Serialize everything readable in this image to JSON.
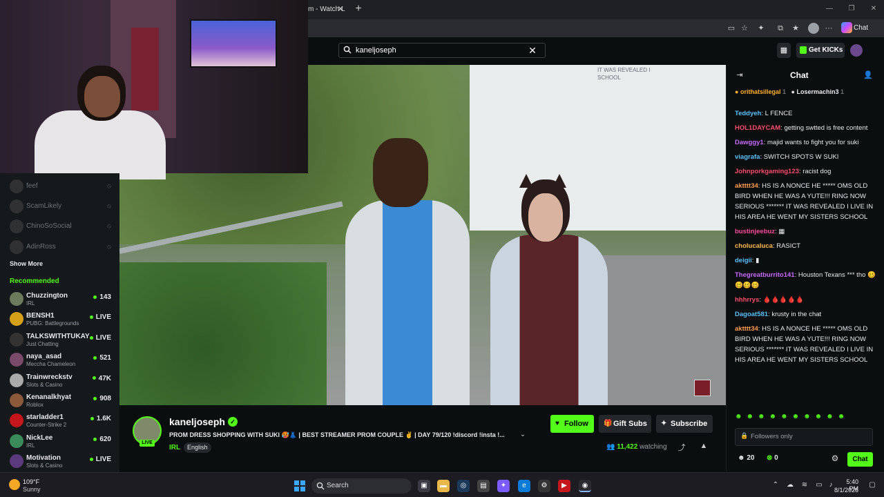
{
  "browser": {
    "tab_title": "m - Watch L",
    "close": "✕",
    "new_tab": "+",
    "controls": [
      "—",
      "❐",
      "✕"
    ],
    "copilot_label": "Chat"
  },
  "header": {
    "search_value": "kaneljoseph",
    "search_clear": "✕",
    "get_kicks": "Get KICKs"
  },
  "sidebar": {
    "following": [
      {
        "name": "feef"
      },
      {
        "name": "ScamLikely"
      },
      {
        "name": "ChinoSoSocial"
      },
      {
        "name": "AdinRoss"
      }
    ],
    "show_more": "Show More",
    "recommended_title": "Recommended",
    "recommended": [
      {
        "name": "Chuzzington",
        "category": "IRL",
        "viewers": "143"
      },
      {
        "name": "BENSH1",
        "category": "PUBG: Battlegrounds",
        "viewers": "LIVE"
      },
      {
        "name": "TALKSWITHTUKAY",
        "category": "Just Chatting",
        "viewers": "LIVE"
      },
      {
        "name": "naya_asad",
        "category": "Meccha Chameleon",
        "viewers": "521"
      },
      {
        "name": "Trainwreckstv",
        "category": "Slots & Casino",
        "viewers": "47K"
      },
      {
        "name": "Kenanalkhyat",
        "category": "Roblox",
        "viewers": "908"
      },
      {
        "name": "starladder1",
        "category": "Counter-Strike 2",
        "viewers": "1.6K"
      },
      {
        "name": "NickLee",
        "category": "IRL",
        "viewers": "620"
      },
      {
        "name": "Motivation",
        "category": "Slots & Casino",
        "viewers": "LIVE"
      }
    ]
  },
  "stream": {
    "overlay_line": "IT WAS REVEALED I",
    "overlay_line2": "SCHOOL",
    "streamer": "kaneljoseph",
    "live": "LIVE",
    "title": "PROM DRESS SHOPPING WITH SUKI 🥵👗 | BEST STREAMER PROM COUPLE ✌️ | DAY 79/120 !discord !insta !...",
    "category": "IRL",
    "tag": "English",
    "follow": "Follow",
    "gift_subs": "Gift Subs",
    "subscribe": "Subscribe",
    "viewers": "11,422",
    "watching": "watching"
  },
  "chat": {
    "title": "Chat",
    "pinned": [
      {
        "name": "orithatsillegal",
        "count": "1"
      },
      {
        "name": "Losermachin3",
        "count": "1"
      }
    ],
    "messages": [
      {
        "user": "Teddyeh",
        "color": "#5bc0ff",
        "text": "L FENCE"
      },
      {
        "user": "HOL1DAYCAM",
        "color": "#ff4d6d",
        "text": "getting swtted is free content"
      },
      {
        "user": "Dawggy1",
        "color": "#c86bff",
        "text": "majid wants to fight you for suki"
      },
      {
        "user": "viagrafa",
        "color": "#5bc0ff",
        "text": "SWITCH SPOTS W SUKI"
      },
      {
        "user": "Johnporkgaming123",
        "color": "#ff4d6d",
        "text": "racist dog"
      },
      {
        "user": "aktttt34",
        "color": "#ff9a4d",
        "text": "HS IS A NONCE HE ***** OMS OLD BIRD WHEN HE WAS A YUTE!!! RING NOW SERIOUS ******* IT WAS REVEALED I LIVE IN HIS AREA HE WENT MY SISTERS SCHOOL"
      },
      {
        "user": "bustinjeebuz",
        "color": "#ff4d9d",
        "text": "▦"
      },
      {
        "user": "cholucaluca",
        "color": "#ffb84d",
        "text": "RASICT"
      },
      {
        "user": "deigii",
        "color": "#5bc0ff",
        "text": "▮"
      },
      {
        "user": "Thegreatburrito141",
        "color": "#c86bff",
        "text": "Houston Texans *** tho 🥴🥴🥴🥴"
      },
      {
        "user": "hhhrrys",
        "color": "#ff4d6d",
        "text": "🩸🩸🩸🩸🩸"
      },
      {
        "user": "Dagoat581",
        "color": "#5bc0ff",
        "text": "krusty in the chat"
      },
      {
        "user": "aktttt34",
        "color": "#ff9a4d",
        "text": "HS IS A NONCE HE ***** OMS OLD BIRD WHEN HE WAS A YUTE!!! RING NOW SERIOUS ******* IT WAS REVEALED I LIVE IN HIS AREA HE WENT MY SISTERS SCHOOL"
      }
    ],
    "emotes": "☻☻☻☻☻☻☻☻☻☻",
    "input_placeholder": "Followers only",
    "points_a": "20",
    "points_b": "0",
    "send": "Chat"
  },
  "taskbar": {
    "temp": "109°F",
    "condition": "Sunny",
    "search": "Search",
    "time": "5:40 PM",
    "date": "8/1/2026"
  },
  "colors": {
    "kick_green": "#53fc18",
    "bg": "#0b0e0f",
    "panel": "#16191c"
  }
}
